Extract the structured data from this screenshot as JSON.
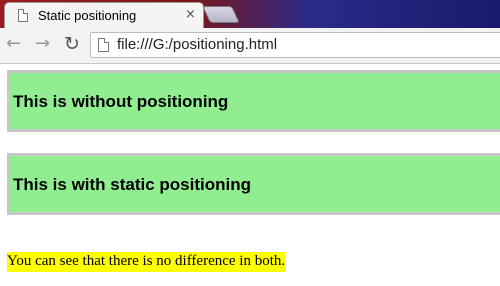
{
  "tab": {
    "title": "Static positioning",
    "close_glyph": "×"
  },
  "toolbar": {
    "back_glyph": "←",
    "forward_glyph": "→",
    "reload_glyph": "↻",
    "url": "file:///G:/positioning.html"
  },
  "page": {
    "box1_heading": "This is without positioning",
    "box2_heading": "This is with static positioning",
    "note": "You can see that there is no difference in both."
  },
  "colors": {
    "box_background": "#90ee90",
    "box_border": "#c8c8c8",
    "note_highlight": "#ffff00"
  }
}
